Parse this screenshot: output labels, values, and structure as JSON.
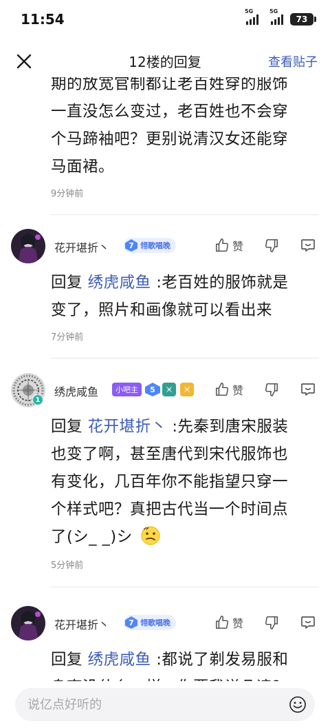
{
  "status": {
    "time": "11:54",
    "net1": "5G",
    "net2": "5G",
    "battery": "73"
  },
  "header": {
    "title": "12楼的回复",
    "view_post": "查看贴子"
  },
  "top_reply": {
    "lines": [
      "期的放宽官制都让老百姓穿的服饰",
      "一直没怎么变过，老百姓也不会穿",
      "个马蹄袖吧？更别说清汉女还能穿",
      "马面裙。"
    ],
    "time": "9分钟前"
  },
  "replies": [
    {
      "username": "花开堪折丶",
      "level": "7",
      "badge_name": "翎歌唱晚",
      "like_label": "赞",
      "reply_word": "回复",
      "mention": "绣虎咸鱼",
      "text_first": ":老百姓的服饰就是",
      "lines": [
        "变了，照片和画像就可以看出来"
      ],
      "time": "7分钟前"
    },
    {
      "username": "绣虎咸鱼",
      "mod_badge": "小吧主",
      "level": "5",
      "avatar_level": "1",
      "like_label": "赞",
      "reply_word": "回复",
      "mention": "花开堪折丶",
      "text_first": ":先秦到唐宋服装",
      "lines": [
        "也变了啊，甚至唐代到宋代服饰也",
        "有变化，几百年你不能指望只穿一",
        "个样式吧？真把古代当一个时间点",
        "了(シ_ _)シ"
      ],
      "time": "5分钟前"
    },
    {
      "username": "花开堪折丶",
      "level": "7",
      "badge_name": "翎歌唱晚",
      "like_label": "赞",
      "reply_word": "回复",
      "mention": "绣虎咸鱼",
      "text_first": ":都说了剃发易服和",
      "lines": [
        "身高没什么一样，你要我说几遍？"
      ]
    }
  ],
  "input": {
    "placeholder": "说亿点好听的"
  },
  "colors": {
    "accent": "#3d5db8",
    "level_badge": "#4f86f7",
    "mod_badge": "#8b5cf6"
  },
  "icons": [
    "close-icon",
    "thumbs-up-icon",
    "thumbs-down-icon",
    "comment-icon",
    "emoji-icon"
  ]
}
